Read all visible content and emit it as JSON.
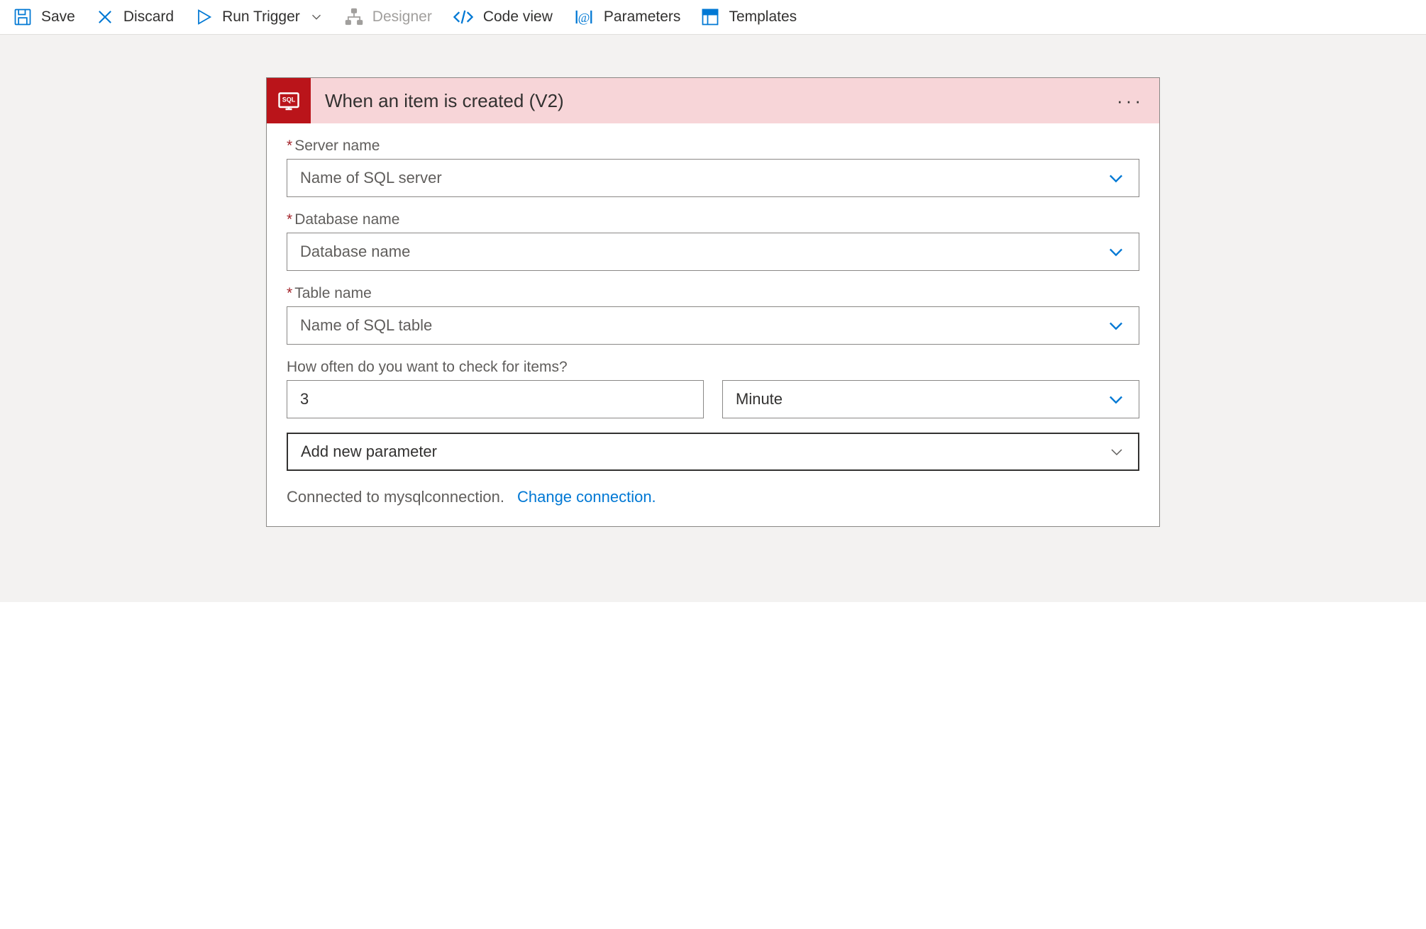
{
  "toolbar": {
    "save_label": "Save",
    "discard_label": "Discard",
    "run_trigger_label": "Run Trigger",
    "designer_label": "Designer",
    "code_view_label": "Code view",
    "parameters_label": "Parameters",
    "templates_label": "Templates"
  },
  "trigger_card": {
    "title": "When an item is created (V2)",
    "fields": {
      "server_name": {
        "label": "Server name",
        "placeholder": "Name of SQL server"
      },
      "database_name": {
        "label": "Database name",
        "placeholder": "Database name"
      },
      "table_name": {
        "label": "Table name",
        "placeholder": "Name of SQL table"
      },
      "frequency": {
        "label": "How often do you want to check for items?",
        "interval_value": "3",
        "unit_value": "Minute"
      }
    },
    "add_parameter_label": "Add new parameter",
    "connection": {
      "status_text": "Connected to mysqlconnection.",
      "change_link": "Change connection."
    }
  }
}
